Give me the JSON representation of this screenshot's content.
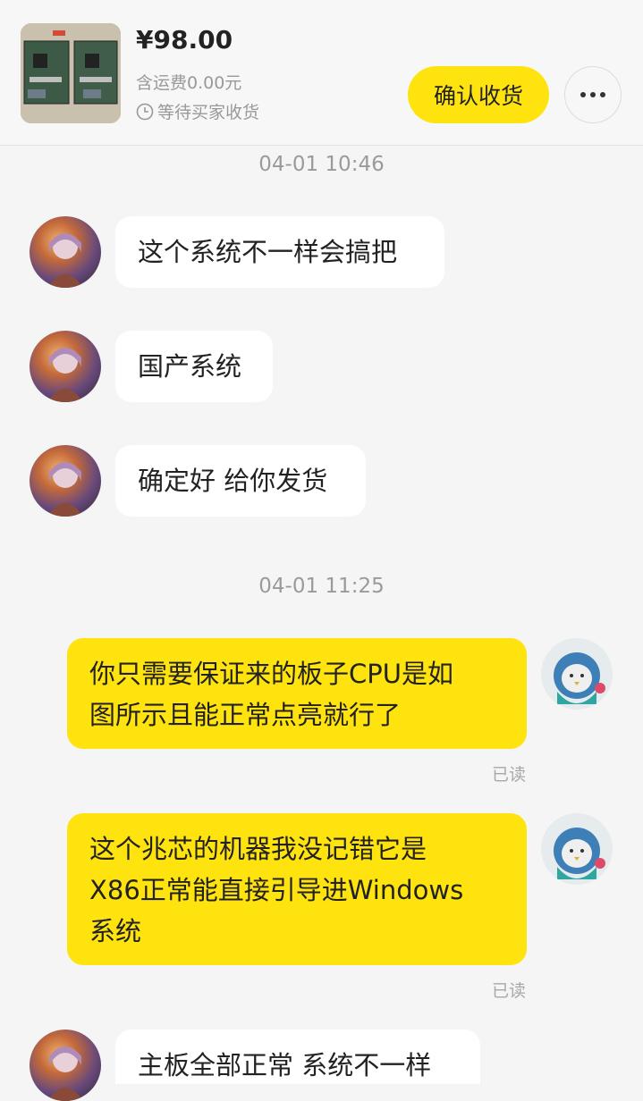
{
  "header": {
    "price": "¥98.00",
    "shipping": "含运费0.00元",
    "status": "等待买家收货",
    "confirm_label": "确认收货"
  },
  "chat": {
    "timestamp_1": "04-01 10:46",
    "timestamp_2": "04-01 11:25",
    "msg_1": "这个系统不一样会搞把",
    "msg_2": "国产系统",
    "msg_3": "确定好 给你发货",
    "msg_4_line1": "你只需要保证来的板子CPU是如",
    "msg_4_line2": "图所示且能正常点亮就行了",
    "msg_5_line1": "这个兆芯的机器我没记错它是",
    "msg_5_line2": "X86正常能直接引导进Windows",
    "msg_5_line3": "系统",
    "msg_6": "主板全部正常 系统不一样",
    "read_label": "已读"
  },
  "icons": {
    "clock": "clock-icon",
    "more": "more-icon"
  },
  "colors": {
    "accent": "#ffe30f",
    "background": "#f5f5f5"
  }
}
